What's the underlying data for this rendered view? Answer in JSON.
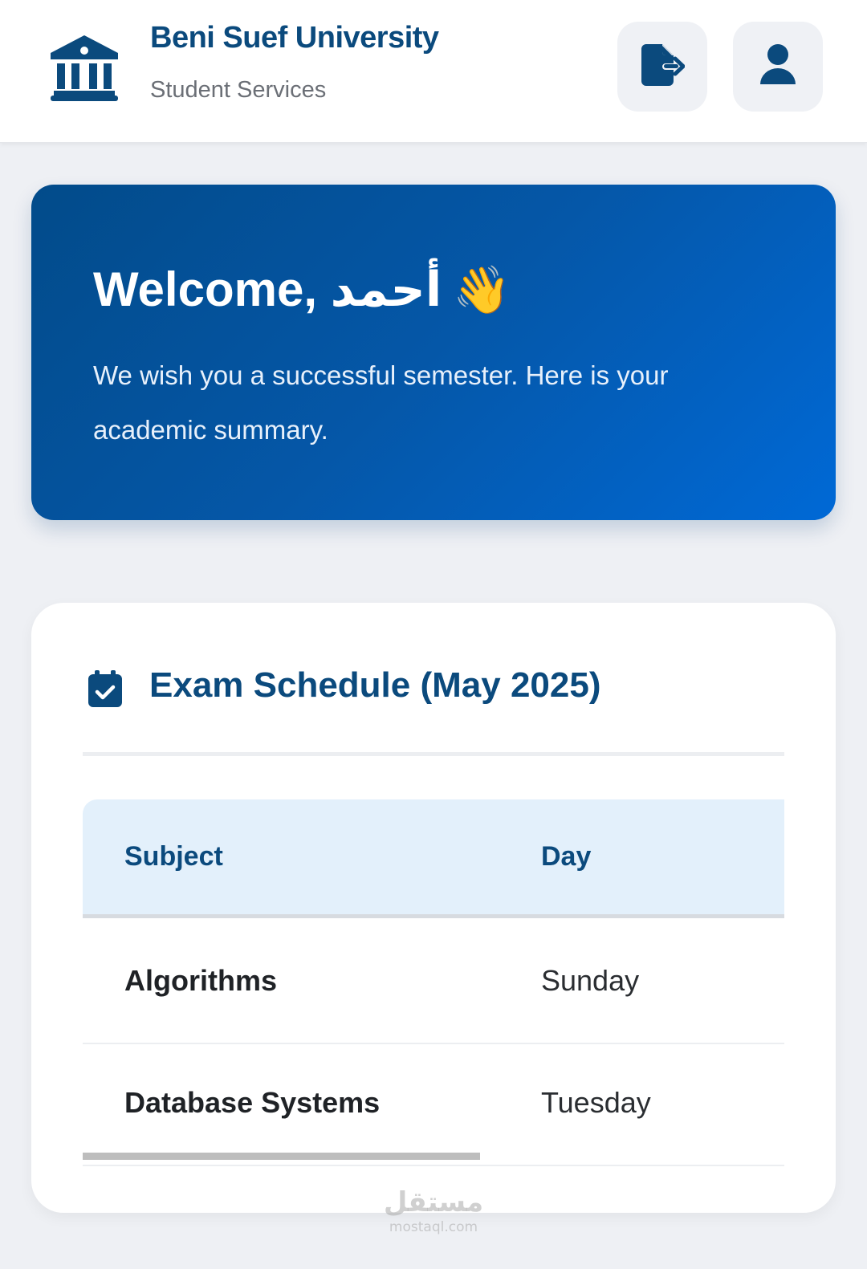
{
  "header": {
    "title": "Beni Suef University",
    "subtitle": "Student Services",
    "logo_icon": "university-building-icon",
    "logout_icon": "file-export-icon",
    "profile_icon": "user-icon"
  },
  "welcome": {
    "greeting": "Welcome, أحمد",
    "emoji": "👋",
    "message": "We wish you a successful semester. Here is your academic summary."
  },
  "exam_schedule": {
    "icon": "calendar-check-icon",
    "title": "Exam Schedule (May 2025)",
    "columns": [
      "Subject",
      "Day"
    ],
    "rows": [
      {
        "subject": "Algorithms",
        "day": "Sunday"
      },
      {
        "subject": "Database Systems",
        "day": "Tuesday"
      }
    ]
  },
  "watermark": {
    "arabic": "مستقل",
    "latin": "mostaql.com"
  },
  "colors": {
    "brand": "#0b4a7d",
    "banner_start": "#024b8a",
    "banner_end": "#0069d6",
    "table_header_bg": "#e3f0fb",
    "page_bg": "#eef0f4"
  }
}
